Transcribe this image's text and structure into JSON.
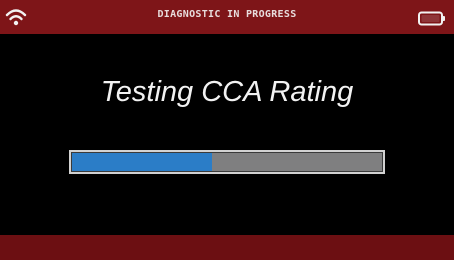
{
  "status_bar": {
    "title": "DIAGNOSTIC IN PROGRESS",
    "wifi_icon": "wifi-icon",
    "battery_icon": "battery-icon",
    "color": "#7e1518"
  },
  "main": {
    "message": "Testing CCA Rating"
  },
  "progress": {
    "fraction": 0.45,
    "fill_color": "#2b7dc7",
    "track_color": "#7f7f80"
  },
  "footer": {
    "color": "#6c0f12"
  }
}
